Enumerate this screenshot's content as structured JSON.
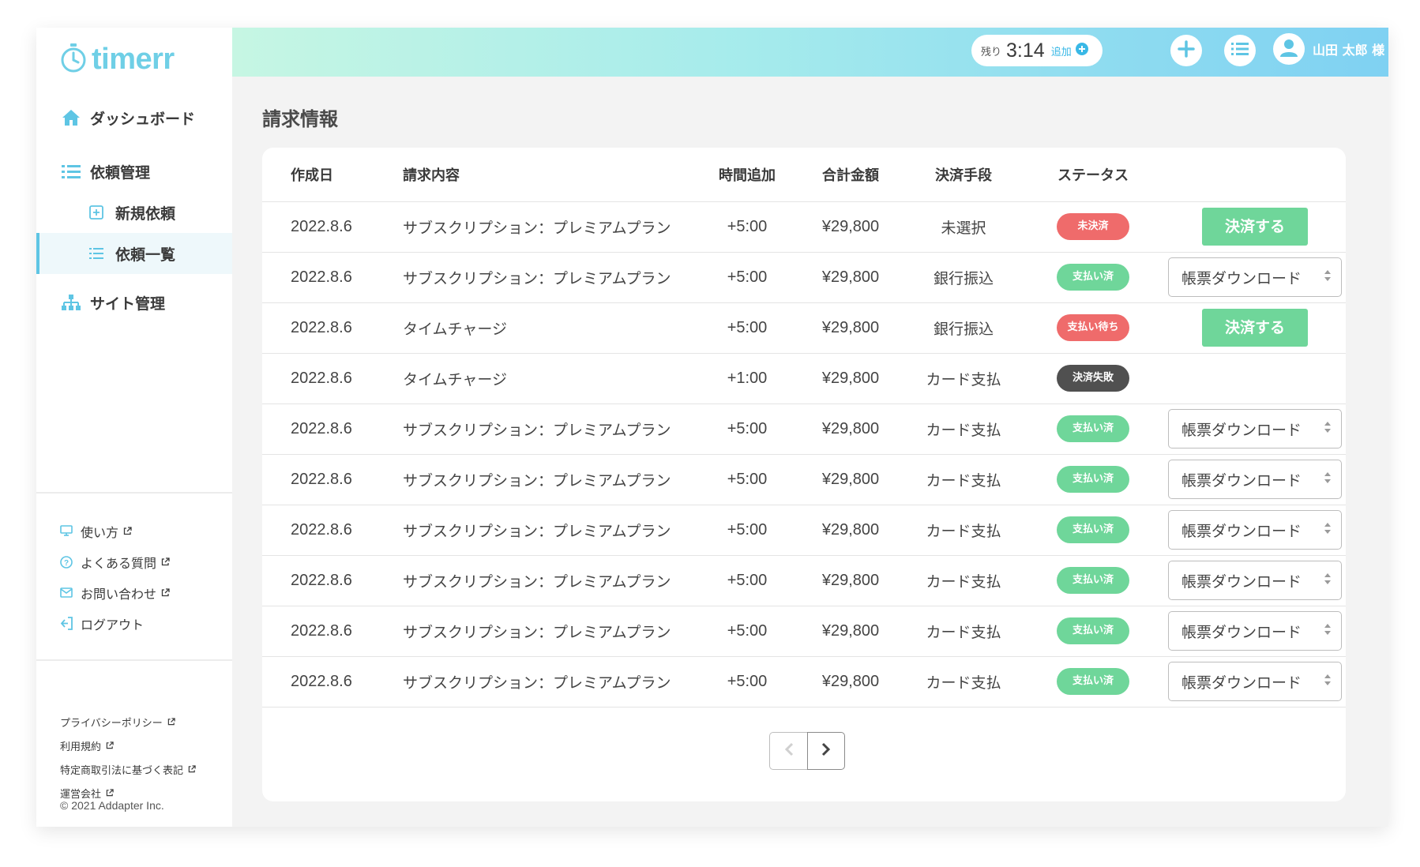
{
  "app": {
    "logo_text": "timerr"
  },
  "header": {
    "timer_label": "残り",
    "timer_value": "3:14",
    "timer_add_label": "追加",
    "user_name": "山田 太郎 様"
  },
  "sidebar": {
    "items": [
      {
        "label": "ダッシュボード"
      },
      {
        "label": "依頼管理"
      },
      {
        "label": "新規依頼"
      },
      {
        "label": "依頼一覧"
      },
      {
        "label": "サイト管理"
      }
    ],
    "links": [
      {
        "label": "使い方"
      },
      {
        "label": "よくある質問"
      },
      {
        "label": "お問い合わせ"
      },
      {
        "label": "ログアウト"
      }
    ],
    "legal": [
      {
        "label": "プライバシーポリシー"
      },
      {
        "label": "利用規約"
      },
      {
        "label": "特定商取引法に基づく表記"
      },
      {
        "label": "運営会社"
      }
    ],
    "copyright": "© 2021 Addapter Inc."
  },
  "main": {
    "title": "請求情報",
    "columns": [
      "作成日",
      "請求内容",
      "時間追加",
      "合計金額",
      "決済手段",
      "ステータス"
    ],
    "rows": [
      {
        "date": "2022.8.6",
        "content": "サブスクリプション：プレミアムプラン",
        "time": "+5:00",
        "total": "¥29,800",
        "method": "未選択",
        "status": "未決済",
        "status_color": "#ef6b6b",
        "action_type": "pay",
        "action": "決済する"
      },
      {
        "date": "2022.8.6",
        "content": "サブスクリプション：プレミアムプラン",
        "time": "+5:00",
        "total": "¥29,800",
        "method": "銀行振込",
        "status": "支払い済",
        "status_color": "#6fd69a",
        "action_type": "download",
        "action": "帳票ダウンロード"
      },
      {
        "date": "2022.8.6",
        "content": "タイムチャージ",
        "time": "+5:00",
        "total": "¥29,800",
        "method": "銀行振込",
        "status": "支払い待ち",
        "status_color": "#ef6b6b",
        "action_type": "pay",
        "action": "決済する"
      },
      {
        "date": "2022.8.6",
        "content": "タイムチャージ",
        "time": "+1:00",
        "total": "¥29,800",
        "method": "カード支払",
        "status": "決済失敗",
        "status_color": "#505050",
        "action_type": "none",
        "action": ""
      },
      {
        "date": "2022.8.6",
        "content": "サブスクリプション：プレミアムプラン",
        "time": "+5:00",
        "total": "¥29,800",
        "method": "カード支払",
        "status": "支払い済",
        "status_color": "#6fd69a",
        "action_type": "download",
        "action": "帳票ダウンロード"
      },
      {
        "date": "2022.8.6",
        "content": "サブスクリプション：プレミアムプラン",
        "time": "+5:00",
        "total": "¥29,800",
        "method": "カード支払",
        "status": "支払い済",
        "status_color": "#6fd69a",
        "action_type": "download",
        "action": "帳票ダウンロード"
      },
      {
        "date": "2022.8.6",
        "content": "サブスクリプション：プレミアムプラン",
        "time": "+5:00",
        "total": "¥29,800",
        "method": "カード支払",
        "status": "支払い済",
        "status_color": "#6fd69a",
        "action_type": "download",
        "action": "帳票ダウンロード"
      },
      {
        "date": "2022.8.6",
        "content": "サブスクリプション：プレミアムプラン",
        "time": "+5:00",
        "total": "¥29,800",
        "method": "カード支払",
        "status": "支払い済",
        "status_color": "#6fd69a",
        "action_type": "download",
        "action": "帳票ダウンロード"
      },
      {
        "date": "2022.8.6",
        "content": "サブスクリプション：プレミアムプラン",
        "time": "+5:00",
        "total": "¥29,800",
        "method": "カード支払",
        "status": "支払い済",
        "status_color": "#6fd69a",
        "action_type": "download",
        "action": "帳票ダウンロード"
      },
      {
        "date": "2022.8.6",
        "content": "サブスクリプション：プレミアムプラン",
        "time": "+5:00",
        "total": "¥29,800",
        "method": "カード支払",
        "status": "支払い済",
        "status_color": "#6fd69a",
        "action_type": "download",
        "action": "帳票ダウンロード"
      }
    ]
  },
  "colors": {
    "accent": "#5ec5e4",
    "pay_button": "#6fd69a",
    "status_paid": "#6fd69a",
    "status_unpaid": "#ef6b6b",
    "status_failed": "#505050"
  }
}
